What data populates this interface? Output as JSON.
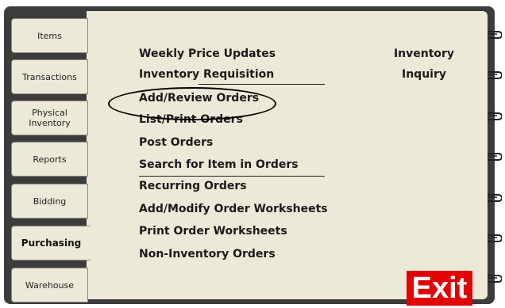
{
  "tabs": [
    {
      "label": "Items"
    },
    {
      "label": "Transactions"
    },
    {
      "label": "Physical Inventory"
    },
    {
      "label": "Reports"
    },
    {
      "label": "Bidding"
    },
    {
      "label": "Purchasing",
      "active": true
    },
    {
      "label": "Warehouse"
    }
  ],
  "menu": {
    "items": [
      {
        "label": "Weekly Price Updates"
      },
      {
        "label": "Inventory Requisition"
      },
      {
        "label": "Add/Review Orders"
      },
      {
        "label": "List/Print Orders"
      },
      {
        "label": "Post Orders"
      },
      {
        "label": "Search for Item in Orders"
      },
      {
        "label": "Recurring Orders"
      },
      {
        "label": "Add/Modify Order Worksheets"
      },
      {
        "label": "Print Order Worksheets"
      },
      {
        "label": "Non-Inventory Orders"
      }
    ]
  },
  "side": {
    "line1": "Inventory",
    "line2": "Inquiry"
  },
  "exit_label": "Exit",
  "colors": {
    "panel": "#ede9d8",
    "exit": "#e20000",
    "frame": "#3c3c3c"
  },
  "icons": [
    "binder-ring-icon"
  ]
}
